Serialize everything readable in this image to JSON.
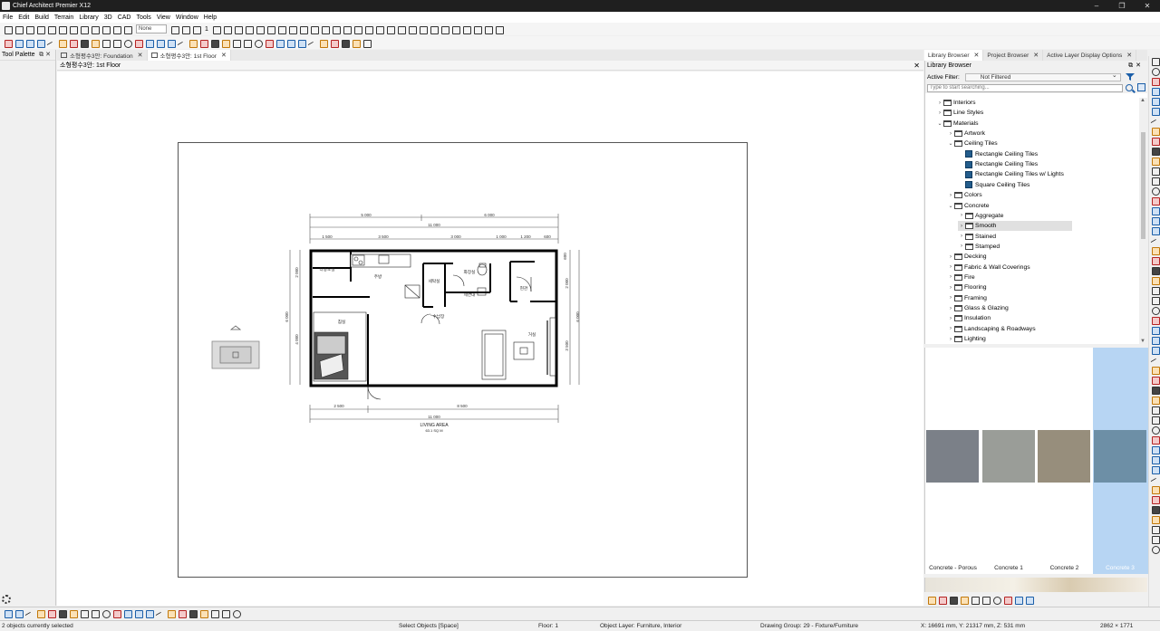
{
  "window": {
    "title": "Chief Architect Premier X12"
  },
  "menu": [
    "File",
    "Edit",
    "Build",
    "Terrain",
    "Library",
    "3D",
    "CAD",
    "Tools",
    "View",
    "Window",
    "Help"
  ],
  "toolbar": {
    "layer_set": "None",
    "floor_num": "1"
  },
  "tool_palette": {
    "title": "Tool Palette"
  },
  "doc_tabs": [
    {
      "label": "소형평수3안: Foundation",
      "active": false
    },
    {
      "label": "소형평수3안: 1st Floor",
      "active": true
    }
  ],
  "view": {
    "title": "소형평수3안: 1st Floor"
  },
  "plan": {
    "dims_top1": [
      "5 000",
      "6 000"
    ],
    "dim_top_total": "11 000",
    "dims_top2": [
      "1 500",
      "3 500",
      "3 000",
      "1 000",
      "1 200",
      "600"
    ],
    "dims_bottom": [
      "2 500",
      "8 500"
    ],
    "dim_bottom_total": "11 000",
    "dims_left": [
      "2 000",
      "4 000"
    ],
    "dim_left_total": "6 000",
    "dims_right": [
      "600",
      "2 000",
      "3 500"
    ],
    "dim_right_total": "6 000",
    "rooms": {
      "dress": "다용도실",
      "kitchen": "주방",
      "bedroom": "침실",
      "utility": "세탁실",
      "bath": "화장실",
      "wash": "세면대",
      "shower": "수납장",
      "entry": "현관",
      "living": "거실"
    },
    "area_label": "LIVING AREA",
    "area_value": "63.1 SQ M"
  },
  "right_tabs": [
    "Library Browser",
    "Project Browser",
    "Active Layer Display Options"
  ],
  "library": {
    "title": "Library Browser",
    "filter_label": "Active Filter:",
    "filter_value": "Not Filtered",
    "search_placeholder": "Type to start searching...",
    "tree": [
      {
        "label": "Interiors",
        "level": 1,
        "kind": "folder",
        "chev": "›"
      },
      {
        "label": "Line Styles",
        "level": 1,
        "kind": "folder",
        "chev": "›"
      },
      {
        "label": "Materials",
        "level": 1,
        "kind": "folder",
        "chev": "⌄"
      },
      {
        "label": "Artwork",
        "level": 2,
        "kind": "folder",
        "chev": "›"
      },
      {
        "label": "Ceiling Tiles",
        "level": 2,
        "kind": "folder",
        "chev": "⌄"
      },
      {
        "label": "Rectangle Ceiling Tiles",
        "level": 3,
        "kind": "mat",
        "chev": ""
      },
      {
        "label": "Rectangle Ceiling Tiles",
        "level": 3,
        "kind": "mat",
        "chev": ""
      },
      {
        "label": "Rectangle Ceiling Tiles w/ Lights",
        "level": 3,
        "kind": "mat",
        "chev": ""
      },
      {
        "label": "Square Ceiling Tiles",
        "level": 3,
        "kind": "mat",
        "chev": ""
      },
      {
        "label": "Colors",
        "level": 2,
        "kind": "folder",
        "chev": "›"
      },
      {
        "label": "Concrete",
        "level": 2,
        "kind": "folder",
        "chev": "⌄"
      },
      {
        "label": "Aggregate",
        "level": 3,
        "kind": "folder",
        "chev": "›"
      },
      {
        "label": "Smooth",
        "level": 3,
        "kind": "folder",
        "chev": "›",
        "selected": true
      },
      {
        "label": "Stained",
        "level": 3,
        "kind": "folder",
        "chev": "›"
      },
      {
        "label": "Stamped",
        "level": 3,
        "kind": "folder",
        "chev": "›"
      },
      {
        "label": "Decking",
        "level": 2,
        "kind": "folder",
        "chev": "›"
      },
      {
        "label": "Fabric & Wall Coverings",
        "level": 2,
        "kind": "folder",
        "chev": "›"
      },
      {
        "label": "Fire",
        "level": 2,
        "kind": "folder",
        "chev": "›"
      },
      {
        "label": "Flooring",
        "level": 2,
        "kind": "folder",
        "chev": "›"
      },
      {
        "label": "Framing",
        "level": 2,
        "kind": "folder",
        "chev": "›"
      },
      {
        "label": "Glass & Glazing",
        "level": 2,
        "kind": "folder",
        "chev": "›"
      },
      {
        "label": "Insulation",
        "level": 2,
        "kind": "folder",
        "chev": "›"
      },
      {
        "label": "Landscaping & Roadways",
        "level": 2,
        "kind": "folder",
        "chev": "›"
      },
      {
        "label": "Lighting",
        "level": 2,
        "kind": "folder",
        "chev": "›"
      }
    ],
    "swatches": [
      {
        "label": "Concrete - Porous",
        "color": "#7b8088",
        "selected": false
      },
      {
        "label": "Concrete 1",
        "color": "#9a9d98",
        "selected": false
      },
      {
        "label": "Concrete 2",
        "color": "#978e7c",
        "selected": false
      },
      {
        "label": "Concrete 3",
        "color": "#6d8fa6",
        "selected": true
      }
    ]
  },
  "status": {
    "selection": "2 objects currently selected",
    "mode": "Select Objects [Space]",
    "floor": "Floor: 1",
    "layer": "Object Layer: Furniture, Interior",
    "group": "Drawing Group: 29 - Fixture/Furniture",
    "coords": "X: 16691 mm, Y: 21317 mm, Z: 531 mm",
    "size": "2862 × 1771"
  }
}
